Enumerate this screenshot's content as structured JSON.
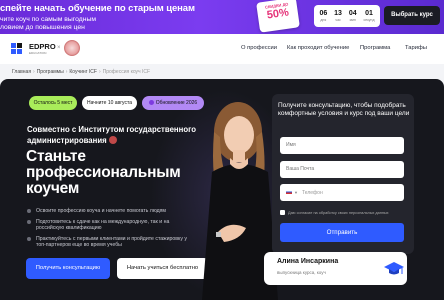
{
  "promo": {
    "line1": "спейте начать обучение по старым ценам",
    "line2": "чите коуч по самым выгодным",
    "line3": "ловием до повышения цен",
    "tag_label": "СКИДКИ ДО",
    "tag_percent": "50%",
    "timer": [
      {
        "num": "06",
        "label": "дня"
      },
      {
        "num": "13",
        "label": "час"
      },
      {
        "num": "04",
        "label": "мин"
      },
      {
        "num": "01",
        "label": "секунд"
      }
    ],
    "button": "Выбрать курс"
  },
  "header": {
    "logo": "EDPRO",
    "logo_sub": "EDUCATION",
    "logo_x": "×",
    "nav": [
      "О профессии",
      "Как проходит обучение",
      "Программа",
      "Тарифы"
    ]
  },
  "breadcrumb": {
    "items": [
      "Главная",
      "Программы",
      "Коучинг ICF"
    ],
    "separator": "›",
    "current": "Профессия коуч ICF"
  },
  "hero": {
    "badges": {
      "left": "Осталось 5 мест",
      "start": "Начните 10 августа",
      "update": "Обновление 2026"
    },
    "partner": "Совместно с Институтом государственного администрирования",
    "headline": "Станьте профессиональным коучем",
    "bullets": [
      "Освоите профессию коуча и начнете помогать людям",
      "Подготовитесь к сдаче как на международную, так и на российскую квалификацию",
      "Практикуйтесь с первыми клиентами и пройдите стажировку у топ-партнеров еще во время учебы"
    ],
    "primary_button": "Получить консультацию",
    "secondary_button": "Начать учиться бесплатно"
  },
  "form": {
    "title": "Получите консультацию, чтобы подобрать комфортные условия и курс под ваши цели",
    "name_placeholder": "Имя",
    "email_placeholder": "Ваша Почта",
    "phone_placeholder": "Телефон",
    "consent": "Даю согласие на обработку своих персональных данных",
    "submit": "Отправить"
  },
  "expert": {
    "name": "Алина Инсаркина",
    "role": "выпускница курса, коуч"
  },
  "colors": {
    "promo": "#6a2bd9",
    "accent_blue": "#2f5bff",
    "hero_bg": "#16171d",
    "badge_green": "#a9ec5a",
    "badge_purple": "#b289f5"
  }
}
